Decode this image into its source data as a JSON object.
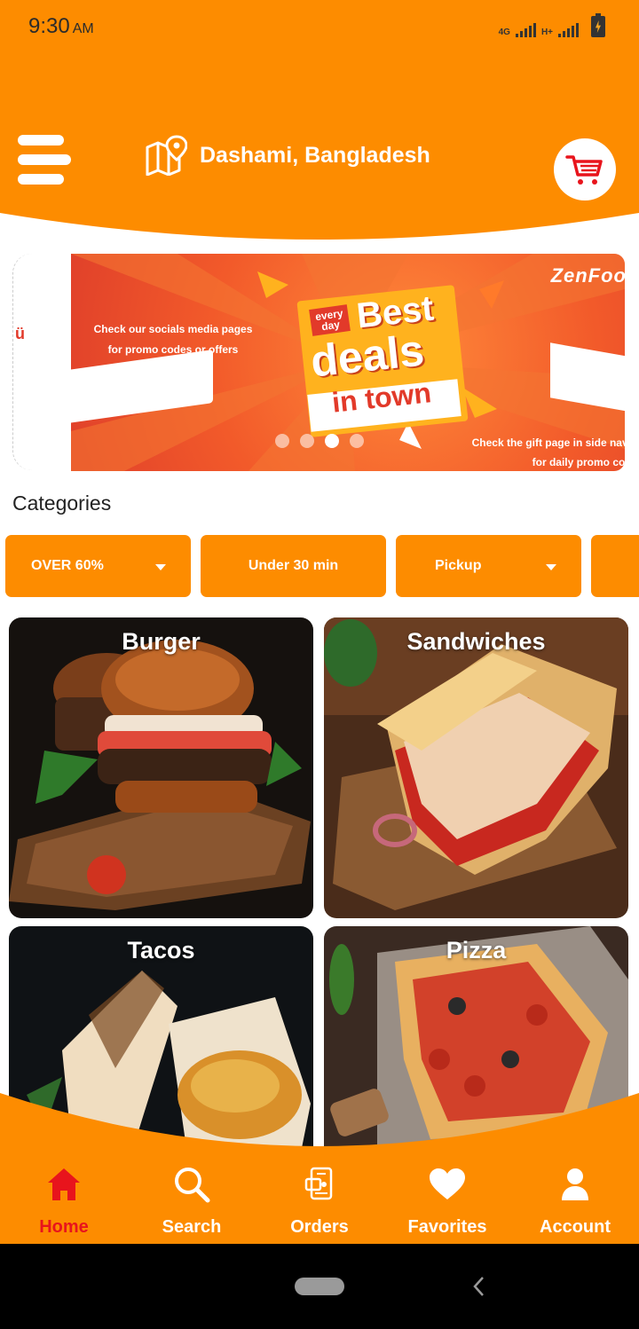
{
  "status_bar": {
    "time": "9:30",
    "ampm": "AM",
    "network1": "4G",
    "network2": "H+"
  },
  "header": {
    "location": "Dashami, Bangladesh",
    "icons": {
      "menu": "hamburger-icon",
      "location": "map-pin-icon",
      "cart": "cart-icon"
    }
  },
  "banner": {
    "brand": "ZenFoo",
    "left_text_1": "Check our socials media pages",
    "left_text_2": "for promo codes or offers",
    "badge_1": "every",
    "badge_2": "day",
    "headline_1": "Best",
    "headline_2": "deals",
    "headline_3": "in town",
    "right_text_1": "Check the gift page in side naviga",
    "right_text_2": "for daily promo codes",
    "slides_total": 4,
    "active_slide": 3,
    "prev_slide_glyph": "ü"
  },
  "categories": {
    "title": "Categories",
    "filters": [
      {
        "label": "OVER 60%",
        "has_dropdown": true
      },
      {
        "label": "Under 30 min",
        "has_dropdown": false
      },
      {
        "label": "Pickup",
        "has_dropdown": true
      }
    ],
    "items": [
      {
        "label": "Burger"
      },
      {
        "label": "Sandwiches"
      },
      {
        "label": "Tacos"
      },
      {
        "label": "Pizza"
      }
    ]
  },
  "bottom_nav": {
    "items": [
      {
        "label": "Home",
        "icon": "home-icon",
        "active": true
      },
      {
        "label": "Search",
        "icon": "search-icon",
        "active": false
      },
      {
        "label": "Orders",
        "icon": "orders-icon",
        "active": false
      },
      {
        "label": "Favorites",
        "icon": "heart-icon",
        "active": false
      },
      {
        "label": "Account",
        "icon": "user-icon",
        "active": false
      }
    ]
  },
  "colors": {
    "primary": "#FD8C00",
    "active": "#E8141C",
    "white": "#FFFFFF"
  }
}
